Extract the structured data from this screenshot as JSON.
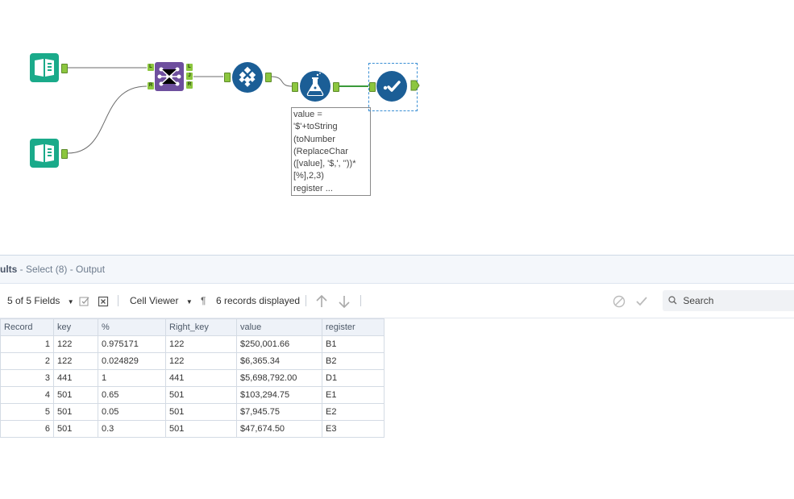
{
  "canvas": {
    "annotation_lines": [
      "value =",
      "'$'+toString",
      "(toNumber",
      "(ReplaceChar",
      "([value], '$,', ''))*",
      "[%],2,3)",
      "register ..."
    ],
    "join_anchors_in": [
      "L",
      "R"
    ],
    "join_anchors_out": [
      "L",
      "J",
      "R"
    ]
  },
  "results": {
    "title_prefix": "ults",
    "title_suffix": " - Select (8) - Output",
    "toolbar": {
      "fields": "5 of 5 Fields",
      "cell_viewer": "Cell Viewer",
      "pilcrow": "¶",
      "records": "6 records displayed",
      "search_placeholder": "Search"
    },
    "columns": [
      "Record",
      "key",
      "%",
      "Right_key",
      "value",
      "register"
    ],
    "rows": [
      [
        "1",
        "122",
        "0.975171",
        "122",
        "$250,001.66",
        "B1"
      ],
      [
        "2",
        "122",
        "0.024829",
        "122",
        "$6,365.34",
        "B2"
      ],
      [
        "3",
        "441",
        "1",
        "441",
        "$5,698,792.00",
        "D1"
      ],
      [
        "4",
        "501",
        "0.65",
        "501",
        "$103,294.75",
        "E1"
      ],
      [
        "5",
        "501",
        "0.05",
        "501",
        "$7,945.75",
        "E2"
      ],
      [
        "6",
        "501",
        "0.3",
        "501",
        "$47,674.50",
        "E3"
      ]
    ]
  },
  "colors": {
    "input_tool": "#1aaa8a",
    "join_tool": "#6e4f9e",
    "blue_tool": "#1b5e96",
    "anchor": "#8cc63f",
    "connector": "#6b6b6b",
    "active_connector": "#3a9a3a"
  }
}
